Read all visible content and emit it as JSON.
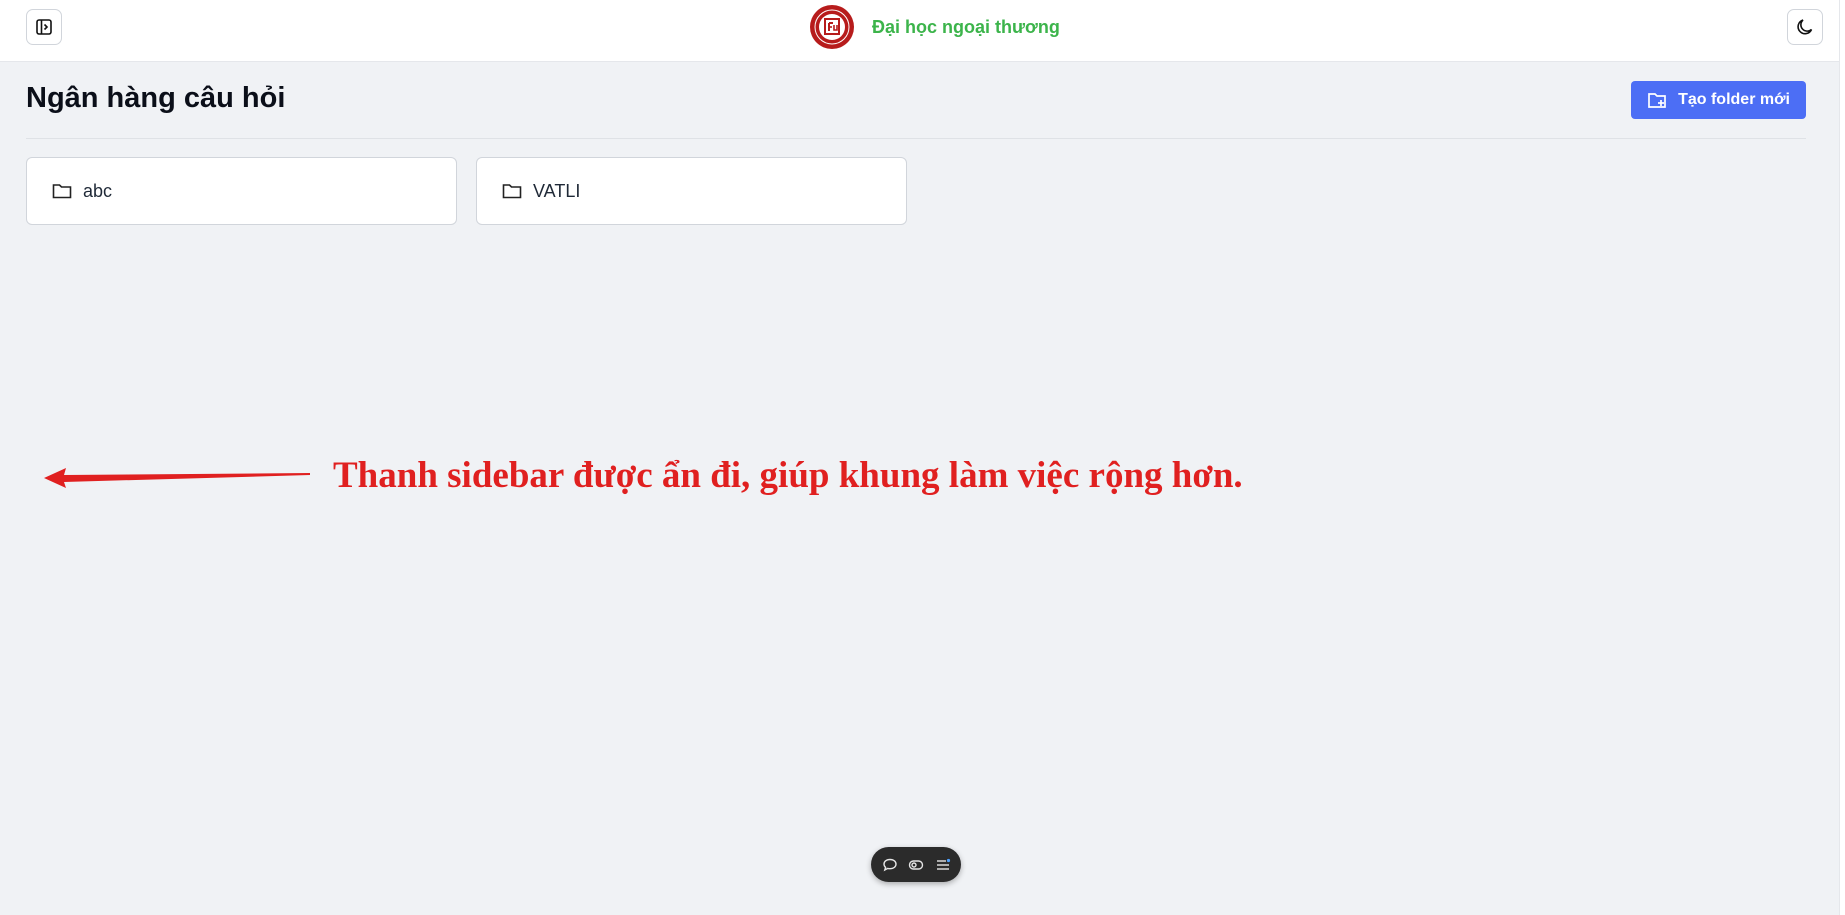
{
  "header": {
    "brand_name": "Đại học ngoại thương",
    "logo_icon": "university-seal-logo",
    "sidebar_toggle_icon": "sidebar-panel-icon",
    "theme_toggle_icon": "moon-icon",
    "brand_color": "#3cb44b"
  },
  "main": {
    "title": "Ngân hàng câu hỏi",
    "new_folder_button": {
      "label": "Tạo folder mới",
      "icon": "folder-plus-icon",
      "color": "#4c6ef5"
    },
    "folders": [
      {
        "name": "abc",
        "icon": "folder-icon"
      },
      {
        "name": "VATLI",
        "icon": "folder-icon"
      }
    ]
  },
  "annotation": {
    "text": "Thanh sidebar được ẩn đi, giúp khung làm việc rộng hơn.",
    "color": "#e02020",
    "arrow_direction": "left"
  },
  "floating_toolbar": {
    "icons": [
      "comment-icon",
      "eye-toggle-icon",
      "list-settings-icon"
    ]
  }
}
